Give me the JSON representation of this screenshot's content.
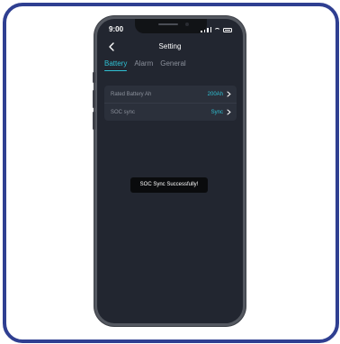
{
  "statusbar": {
    "time": "9:00",
    "icons": [
      "signal-icon",
      "wifi-icon",
      "battery-icon"
    ]
  },
  "header": {
    "title": "Setting",
    "back_icon": "chevron-left-icon"
  },
  "tabs": [
    {
      "label": "Battery",
      "active": true
    },
    {
      "label": "Alarm",
      "active": false
    },
    {
      "label": "General",
      "active": false
    }
  ],
  "settings": {
    "rows": [
      {
        "label": "Rated Battery Ah",
        "value": "200Ah",
        "icon": "chevron-right-icon"
      },
      {
        "label": "SOC sync",
        "value": "Sync",
        "icon": "chevron-right-icon"
      }
    ]
  },
  "toast": {
    "message": "SOC Sync Successfully!"
  },
  "colors": {
    "accent": "#2fc1d4",
    "background": "#222630",
    "card": "#2b303b",
    "frame_border": "#2f3f91"
  }
}
